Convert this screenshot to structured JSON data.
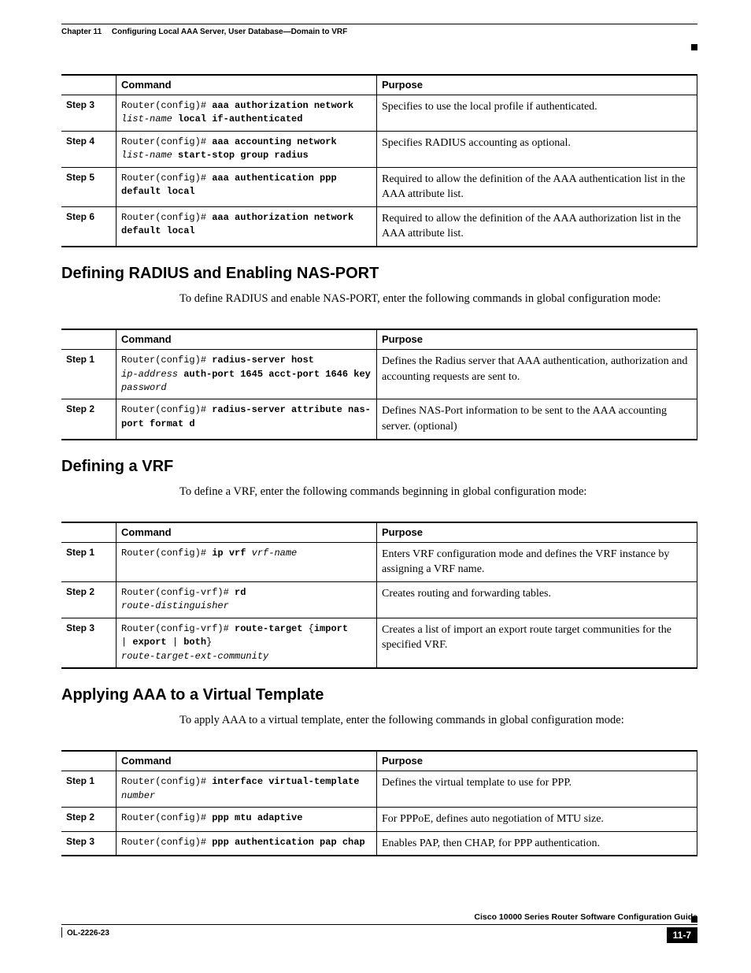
{
  "header": {
    "chapter": "Chapter 11",
    "title": "Configuring Local AAA Server, User Database—Domain to VRF"
  },
  "table1": {
    "headers": {
      "command": "Command",
      "purpose": "Purpose"
    },
    "rows": [
      {
        "step": "Step 3",
        "prompt": "Router(config)# ",
        "bold1": "aaa authorization network",
        "ital1": "list-name",
        "bold2": "local if-authenticated",
        "purpose": "Specifies to use the local profile if authenticated."
      },
      {
        "step": "Step 4",
        "prompt": "Router(config)# ",
        "bold1": "aaa accounting network",
        "ital1": "list-name",
        "bold2": "start-stop group radius",
        "purpose": "Specifies RADIUS accounting as optional."
      },
      {
        "step": "Step 5",
        "prompt": "Router(config)# ",
        "bold1": "aaa authentication ppp default local",
        "purpose": "Required to allow the definition of the AAA authentication list in the AAA attribute list."
      },
      {
        "step": "Step 6",
        "prompt": "Router(config)# ",
        "bold1": "aaa authorization network default local",
        "purpose": "Required to allow the definition of the AAA authorization list in the AAA attribute list."
      }
    ]
  },
  "section1": {
    "heading": "Defining RADIUS and Enabling NAS-PORT",
    "intro": "To define RADIUS and enable NAS-PORT, enter the following commands in global configuration mode:",
    "headers": {
      "command": "Command",
      "purpose": "Purpose"
    },
    "rows": [
      {
        "step": "Step 1",
        "prompt": "Router(config)# ",
        "bold1": "radius-server host",
        "ital1": "ip-address",
        "bold2": "auth-port 1645 acct-port 1646 key",
        "ital2": "password",
        "purpose": "Defines the Radius server that AAA authentication, authorization and accounting requests are sent to."
      },
      {
        "step": "Step 2",
        "prompt": "Router(config)# ",
        "bold1": "radius-server attribute nas-port format d",
        "purpose": "Defines NAS-Port information to be sent to the AAA accounting server. (optional)"
      }
    ]
  },
  "section2": {
    "heading": "Defining a VRF",
    "intro": "To define a VRF, enter the following commands beginning in global configuration mode:",
    "headers": {
      "command": "Command",
      "purpose": "Purpose"
    },
    "rows": [
      {
        "step": "Step 1",
        "prompt": "Router(config)# ",
        "bold1": "ip vrf",
        "ital1": "vrf-name",
        "purpose": "Enters VRF configuration mode and defines the VRF instance by assigning a VRF name."
      },
      {
        "step": "Step 2",
        "prompt": "Router(config-vrf)# ",
        "bold1": "rd",
        "ital1": "route-distinguisher",
        "purpose": "Creates routing and forwarding tables."
      },
      {
        "step": "Step 3",
        "prompt": "Router(config-vrf)# ",
        "bold1": "route-target",
        "plain1": " {",
        "bold2": "import",
        "plain2": " | ",
        "bold3": "export",
        "plain3": " | ",
        "bold4": "both",
        "plain4": "} ",
        "ital1": "route-target-ext-community",
        "purpose": "Creates a list of import an export route target communities for the specified VRF."
      }
    ]
  },
  "section3": {
    "heading": "Applying AAA to a Virtual Template",
    "intro": "To apply AAA to a virtual template, enter the following commands in global configuration mode:",
    "headers": {
      "command": "Command",
      "purpose": "Purpose"
    },
    "rows": [
      {
        "step": "Step 1",
        "prompt": "Router(config)# ",
        "bold1": "interface virtual-template",
        "ital1": "number",
        "purpose": "Defines the virtual template to use for PPP."
      },
      {
        "step": "Step 2",
        "prompt": "Router(config)# ",
        "bold1": "ppp mtu adaptive",
        "purpose": "For PPPoE, defines auto negotiation of MTU size."
      },
      {
        "step": "Step 3",
        "prompt": "Router(config)# ",
        "bold1": "ppp authentication pap chap",
        "purpose": "Enables PAP, then CHAP, for PPP authentication."
      }
    ]
  },
  "footer": {
    "guide": "Cisco 10000 Series Router Software Configuration Guide",
    "doc_id": "OL-2226-23",
    "page": "11-7"
  }
}
